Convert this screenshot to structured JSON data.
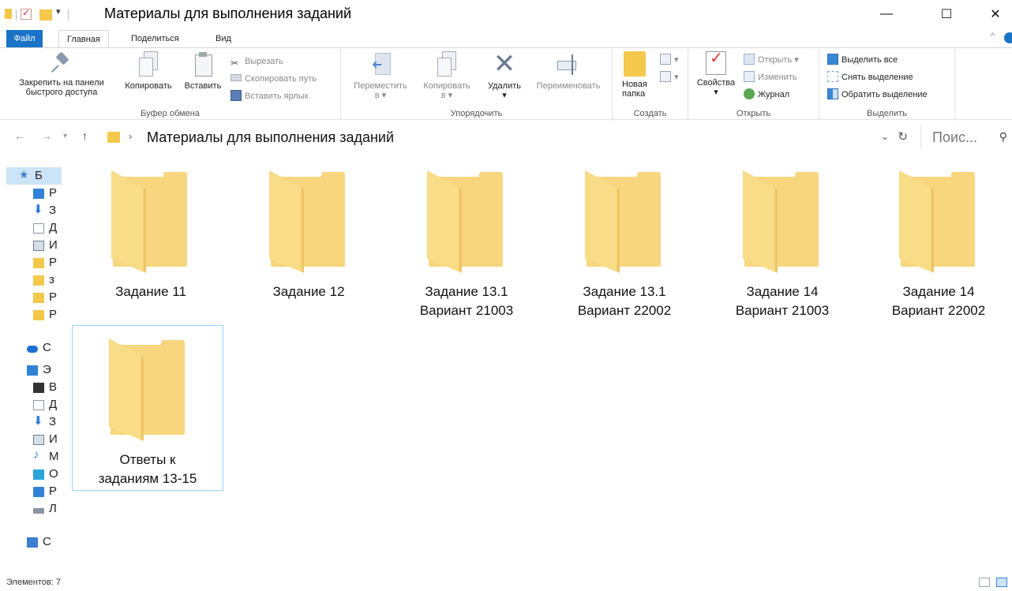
{
  "window": {
    "title": "Материалы для выполнения заданий",
    "controls": {
      "minimize": "—",
      "maximize": "☐",
      "close": "✕"
    }
  },
  "tabs": {
    "file": "Файл",
    "home": "Главная",
    "share": "Поделиться",
    "view": "Вид"
  },
  "ribbon": {
    "clipboard": {
      "label": "Буфер обмена",
      "pin_line1": "Закрепить на панели",
      "pin_line2": "быстрого доступа",
      "copy": "Копировать",
      "paste": "Вставить",
      "cut": "Вырезать",
      "copy_path": "Скопировать путь",
      "paste_shortcut": "Вставить ярлык"
    },
    "organize": {
      "label": "Упорядочить",
      "move": "Переместить",
      "move_sub": "в ▾",
      "copy_to": "Копировать",
      "copy_to_sub": "в ▾",
      "delete": "Удалить",
      "delete_sub": "▾",
      "rename": "Переименовать"
    },
    "new": {
      "label": "Создать",
      "new_folder_line1": "Новая",
      "new_folder_line2": "папка"
    },
    "open": {
      "label": "Открыть",
      "properties": "Свойства",
      "properties_sub": "▾",
      "open": "Открыть ▾",
      "edit": "Изменить",
      "history": "Журнал"
    },
    "select": {
      "label": "Выделить",
      "select_all": "Выделить все",
      "select_none": "Снять выделение",
      "invert": "Обратить выделение"
    }
  },
  "address": {
    "path": "Материалы для выполнения заданий",
    "search_placeholder": "Поис..."
  },
  "navpane": {
    "items": [
      {
        "icon": "star-icon",
        "label": "Б"
      },
      {
        "icon": "desktop-icon",
        "label": "Р"
      },
      {
        "icon": "download-icon",
        "label": "З"
      },
      {
        "icon": "document-icon",
        "label": "Д"
      },
      {
        "icon": "pictures-icon",
        "label": "И"
      },
      {
        "icon": "folder-icon",
        "label": "Р"
      },
      {
        "icon": "folder-icon",
        "label": "з"
      },
      {
        "icon": "folder-icon",
        "label": "Р"
      },
      {
        "icon": "folder-icon",
        "label": "Р"
      },
      {
        "icon": "onedrive-icon",
        "label": "C"
      },
      {
        "icon": "computer-icon",
        "label": "Э"
      },
      {
        "icon": "video-icon",
        "label": "В"
      },
      {
        "icon": "document-icon",
        "label": "Д"
      },
      {
        "icon": "download-icon",
        "label": "З"
      },
      {
        "icon": "pictures-icon",
        "label": "И"
      },
      {
        "icon": "music-icon",
        "label": "М"
      },
      {
        "icon": "objects3d-icon",
        "label": "О"
      },
      {
        "icon": "desktop-icon",
        "label": "Р"
      },
      {
        "icon": "drive-icon",
        "label": "Л"
      },
      {
        "icon": "network-icon",
        "label": "С"
      }
    ]
  },
  "files": [
    {
      "line1": "Задание 11",
      "line2": ""
    },
    {
      "line1": "Задание 12",
      "line2": ""
    },
    {
      "line1": "Задание 13.1",
      "line2": "Вариант 21003"
    },
    {
      "line1": "Задание 13.1",
      "line2": "Вариант 22002"
    },
    {
      "line1": "Задание 14",
      "line2": "Вариант 21003"
    },
    {
      "line1": "Задание 14",
      "line2": "Вариант 22002"
    },
    {
      "line1": "Ответы к",
      "line2": "заданиям 13-15"
    }
  ],
  "status": {
    "items_count": "Элементов: 7"
  },
  "colors": {
    "accent": "#1a73c6",
    "folder": "#f7d67d",
    "selection_border": "#99d1ff"
  }
}
